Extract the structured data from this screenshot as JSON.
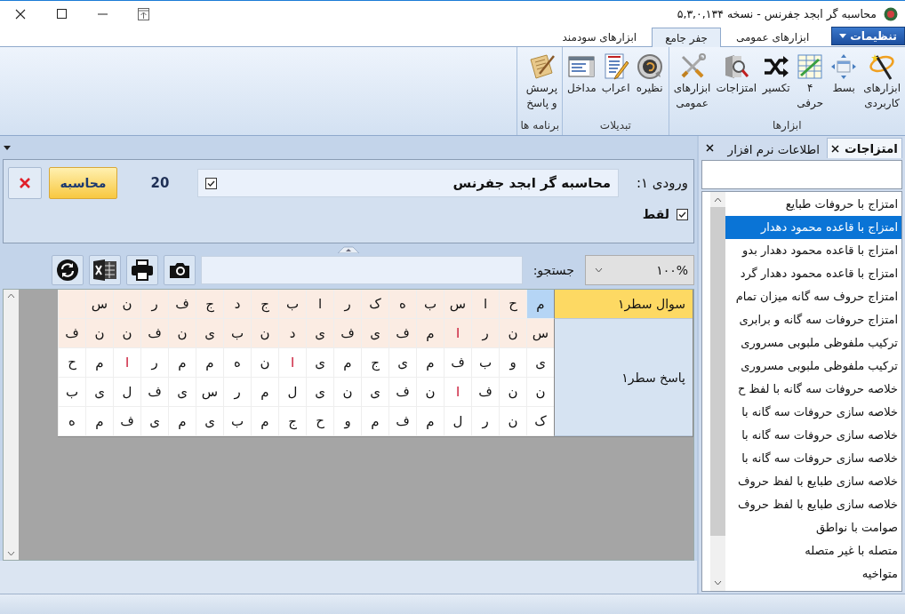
{
  "window": {
    "title": "محاسبه گر ابجد جفرنس - نسخه ۵,۳,۰,۱۳۴"
  },
  "ribbon": {
    "menu_button": "تنظیمات",
    "tabs": [
      {
        "label": "ابزارهای عمومی",
        "selected": false
      },
      {
        "label": "جفر جامع",
        "selected": true
      },
      {
        "label": "ابزارهای سودمند",
        "selected": false
      }
    ],
    "groups": [
      {
        "label": "ابزارها",
        "items": [
          {
            "label": "ابزارهای\nکاربردی",
            "kind": "wand"
          },
          {
            "label": "بسط",
            "kind": "expand"
          },
          {
            "label": "۴\nحرفی",
            "kind": "table"
          },
          {
            "label": "تکسیر",
            "kind": "shuffle"
          },
          {
            "label": "امتزاجات",
            "kind": "magnifier"
          },
          {
            "label": "ابزارهای\nعمومی",
            "kind": "tools"
          }
        ]
      },
      {
        "label": "تبدیلات",
        "items": [
          {
            "label": "نظیره",
            "kind": "disc"
          },
          {
            "label": "اعراب",
            "kind": "document"
          },
          {
            "label": "مداخل",
            "kind": "list"
          }
        ]
      },
      {
        "label": "برنامه ها",
        "items": [
          {
            "label": "پرسش\nو پاسخ",
            "kind": "scroll"
          }
        ]
      }
    ]
  },
  "input": {
    "label": "ورودی ۱:",
    "value": "محاسبه گر ابجد جفرنس",
    "checked": true,
    "count": "20",
    "calculate_button": "محاسبه",
    "option": {
      "label": "لقط",
      "checked": true
    }
  },
  "toolbar": {
    "zoom": "۱۰۰%",
    "search_label": "جستجو:"
  },
  "grid": {
    "sections": [
      {
        "header": "سوال سطر۱",
        "selected": true,
        "rows": [
          {
            "shaded": true,
            "cells": [
              {
                "text": "م",
                "marked": false,
                "selected": true
              },
              {
                "text": "ح",
                "marked": false,
                "selected": false
              },
              {
                "text": "ا",
                "marked": false,
                "selected": false
              },
              {
                "text": "س",
                "marked": false,
                "selected": false
              },
              {
                "text": "ب",
                "marked": false,
                "selected": false
              },
              {
                "text": "ه",
                "marked": false,
                "selected": false
              },
              {
                "text": "ک",
                "marked": false,
                "selected": false
              },
              {
                "text": "ر",
                "marked": false,
                "selected": false
              },
              {
                "text": "ا",
                "marked": false,
                "selected": false
              },
              {
                "text": "ب",
                "marked": false,
                "selected": false
              },
              {
                "text": "ج",
                "marked": false,
                "selected": false
              },
              {
                "text": "د",
                "marked": false,
                "selected": false
              },
              {
                "text": "ج",
                "marked": false,
                "selected": false
              },
              {
                "text": "ف",
                "marked": false,
                "selected": false
              },
              {
                "text": "ر",
                "marked": false,
                "selected": false
              },
              {
                "text": "ن",
                "marked": false,
                "selected": false
              },
              {
                "text": "س",
                "marked": false,
                "selected": false
              }
            ]
          }
        ]
      },
      {
        "header": "پاسخ سطر۱",
        "selected": false,
        "rows": [
          {
            "shaded": true,
            "cells": [
              {
                "text": "س",
                "marked": false,
                "selected": false
              },
              {
                "text": "ن",
                "marked": false,
                "selected": false
              },
              {
                "text": "ر",
                "marked": false,
                "selected": false
              },
              {
                "text": "ا",
                "marked": true,
                "selected": false
              },
              {
                "text": "م",
                "marked": false,
                "selected": false
              },
              {
                "text": "ف",
                "marked": false,
                "selected": false
              },
              {
                "text": "ی",
                "marked": false,
                "selected": false
              },
              {
                "text": "ف",
                "marked": false,
                "selected": false
              },
              {
                "text": "ی",
                "marked": false,
                "selected": false
              },
              {
                "text": "د",
                "marked": false,
                "selected": false
              },
              {
                "text": "ن",
                "marked": false,
                "selected": false
              },
              {
                "text": "ب",
                "marked": false,
                "selected": false
              },
              {
                "text": "ی",
                "marked": false,
                "selected": false
              },
              {
                "text": "ن",
                "marked": false,
                "selected": false
              },
              {
                "text": "ف",
                "marked": false,
                "selected": false
              },
              {
                "text": "ن",
                "marked": false,
                "selected": false
              },
              {
                "text": "ن",
                "marked": false,
                "selected": false
              },
              {
                "text": "ف",
                "marked": false,
                "selected": false
              }
            ]
          },
          {
            "shaded": false,
            "cells": [
              {
                "text": "ی",
                "marked": false,
                "selected": false
              },
              {
                "text": "و",
                "marked": false,
                "selected": false
              },
              {
                "text": "ب",
                "marked": false,
                "selected": false
              },
              {
                "text": "ف",
                "marked": false,
                "selected": false
              },
              {
                "text": "م",
                "marked": false,
                "selected": false
              },
              {
                "text": "ی",
                "marked": false,
                "selected": false
              },
              {
                "text": "ج",
                "marked": false,
                "selected": false
              },
              {
                "text": "م",
                "marked": false,
                "selected": false
              },
              {
                "text": "ی",
                "marked": false,
                "selected": false
              },
              {
                "text": "ا",
                "marked": true,
                "selected": false
              },
              {
                "text": "ن",
                "marked": false,
                "selected": false
              },
              {
                "text": "ه",
                "marked": false,
                "selected": false
              },
              {
                "text": "م",
                "marked": false,
                "selected": false
              },
              {
                "text": "م",
                "marked": false,
                "selected": false
              },
              {
                "text": "ر",
                "marked": false,
                "selected": false
              },
              {
                "text": "ا",
                "marked": true,
                "selected": false
              },
              {
                "text": "م",
                "marked": false,
                "selected": false
              },
              {
                "text": "ح",
                "marked": false,
                "selected": false
              }
            ]
          },
          {
            "shaded": false,
            "cells": [
              {
                "text": "ن",
                "marked": false,
                "selected": false
              },
              {
                "text": "ن",
                "marked": false,
                "selected": false
              },
              {
                "text": "ف",
                "marked": false,
                "selected": false
              },
              {
                "text": "ا",
                "marked": true,
                "selected": false
              },
              {
                "text": "ن",
                "marked": false,
                "selected": false
              },
              {
                "text": "ف",
                "marked": false,
                "selected": false
              },
              {
                "text": "ی",
                "marked": false,
                "selected": false
              },
              {
                "text": "ن",
                "marked": false,
                "selected": false
              },
              {
                "text": "ی",
                "marked": false,
                "selected": false
              },
              {
                "text": "ل",
                "marked": false,
                "selected": false
              },
              {
                "text": "م",
                "marked": false,
                "selected": false
              },
              {
                "text": "ر",
                "marked": false,
                "selected": false
              },
              {
                "text": "س",
                "marked": false,
                "selected": false
              },
              {
                "text": "ی",
                "marked": false,
                "selected": false
              },
              {
                "text": "ف",
                "marked": false,
                "selected": false
              },
              {
                "text": "ل",
                "marked": false,
                "selected": false
              },
              {
                "text": "ی",
                "marked": false,
                "selected": false
              },
              {
                "text": "ب",
                "marked": false,
                "selected": false
              }
            ]
          },
          {
            "shaded": false,
            "cells": [
              {
                "text": "ک",
                "marked": false,
                "selected": false
              },
              {
                "text": "ن",
                "marked": false,
                "selected": false
              },
              {
                "text": "ر",
                "marked": false,
                "selected": false
              },
              {
                "text": "ل",
                "marked": false,
                "selected": false
              },
              {
                "text": "م",
                "marked": false,
                "selected": false
              },
              {
                "text": "ف",
                "marked": false,
                "selected": false
              },
              {
                "text": "م",
                "marked": false,
                "selected": false
              },
              {
                "text": "و",
                "marked": false,
                "selected": false
              },
              {
                "text": "ح",
                "marked": false,
                "selected": false
              },
              {
                "text": "ج",
                "marked": false,
                "selected": false
              },
              {
                "text": "م",
                "marked": false,
                "selected": false
              },
              {
                "text": "ب",
                "marked": false,
                "selected": false
              },
              {
                "text": "ی",
                "marked": false,
                "selected": false
              },
              {
                "text": "م",
                "marked": false,
                "selected": false
              },
              {
                "text": "ی",
                "marked": false,
                "selected": false
              },
              {
                "text": "ف",
                "marked": false,
                "selected": false
              },
              {
                "text": "م",
                "marked": false,
                "selected": false
              },
              {
                "text": "ه",
                "marked": false,
                "selected": false
              }
            ]
          }
        ]
      }
    ]
  },
  "side_panel": {
    "tabs": [
      {
        "label": "امتزاجات",
        "selected": true
      },
      {
        "label": "اطلاعات نرم افزار",
        "selected": false
      }
    ],
    "items": [
      {
        "label": "امتزاج با حروفات طبایع",
        "selected": false
      },
      {
        "label": "امتزاج با قاعده محمود دهدار",
        "selected": true
      },
      {
        "label": "امتزاج با قاعده محمود دهدار بدو",
        "selected": false
      },
      {
        "label": "امتزاج با قاعده محمود دهدار گرد",
        "selected": false
      },
      {
        "label": "امتزاج حروف سه گانه میزان تمام",
        "selected": false
      },
      {
        "label": "امتزاج حروفات سه گانه و برابری",
        "selected": false
      },
      {
        "label": "ترکیب ملفوظی ملبوبی مسروری",
        "selected": false
      },
      {
        "label": "ترکیب ملفوظی ملبوبی مسروری",
        "selected": false
      },
      {
        "label": "خلاصه حروفات سه گانه با لفظ ح",
        "selected": false
      },
      {
        "label": "خلاصه سازی حروفات سه گانه با",
        "selected": false
      },
      {
        "label": "خلاصه سازی حروفات سه گانه با",
        "selected": false
      },
      {
        "label": "خلاصه سازی حروفات سه گانه با",
        "selected": false
      },
      {
        "label": "خلاصه سازی طبایع با لفظ حروف",
        "selected": false
      },
      {
        "label": "خلاصه سازی طبایع با لفظ حروف",
        "selected": false
      },
      {
        "label": "صوامت با نواطق",
        "selected": false
      },
      {
        "label": "متصله با غیر متصله",
        "selected": false
      },
      {
        "label": "متواخیه",
        "selected": false
      }
    ]
  }
}
